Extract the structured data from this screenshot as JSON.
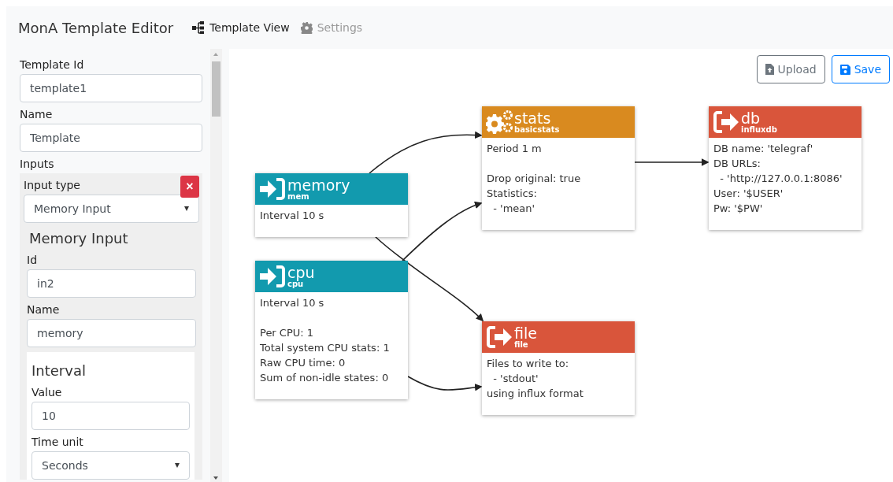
{
  "header": {
    "title": "MonA Template Editor",
    "nav": [
      {
        "label": "Template View",
        "kind": "tree",
        "selected": true
      },
      {
        "label": "Settings",
        "kind": "gear",
        "selected": false
      }
    ]
  },
  "form": {
    "fields": [
      {
        "label": "Template Id",
        "value": "template1"
      },
      {
        "label": "Name",
        "value": "Template"
      }
    ],
    "inputs_label": "Inputs",
    "input_card": {
      "type_label": "Input type",
      "type_value": "Memory Input",
      "remove_button": "×",
      "heading": "Memory Input",
      "fields": [
        {
          "label": "Id",
          "value": "in2"
        },
        {
          "label": "Name",
          "value": "memory"
        }
      ],
      "interval": {
        "heading": "Interval",
        "value_label": "Value",
        "value": "10",
        "unit_label": "Time unit",
        "unit": "Seconds"
      }
    }
  },
  "toolbar": {
    "buttons": [
      {
        "label": "Upload",
        "kind": "upload"
      },
      {
        "label": "Save",
        "kind": "save"
      }
    ]
  },
  "nodes": [
    {
      "kind": "processor",
      "title": "stats",
      "subtitle": "basicstats",
      "color": "#d98a1f",
      "sections": [
        [
          "Period 1 m"
        ],
        [
          "Drop original: true",
          "Statistics:",
          "  - 'mean'"
        ]
      ]
    },
    {
      "kind": "output",
      "title": "db",
      "subtitle": "influxdb",
      "color": "#d9553b",
      "sections": [
        [
          "DB name: 'telegraf'",
          "DB URLs:",
          "  - 'http://127.0.0.1:8086'",
          "User: '$USER'",
          "Pw: '$PW'"
        ]
      ]
    },
    {
      "kind": "input",
      "title": "memory",
      "subtitle": "mem",
      "color": "#129aae",
      "sections": [
        [
          "Interval 10 s"
        ]
      ]
    },
    {
      "kind": "input",
      "title": "cpu",
      "subtitle": "cpu",
      "color": "#129aae",
      "sections": [
        [
          "Interval 10 s"
        ],
        [
          "Per CPU: 1",
          "Total system CPU stats: 1",
          "Raw CPU time: 0",
          "Sum of non-idle states: 0"
        ]
      ]
    },
    {
      "kind": "output",
      "title": "file",
      "subtitle": "file",
      "color": "#d9553b",
      "sections": [
        [
          "Files to write to:",
          "  - 'stdout'",
          "using influx format"
        ]
      ]
    }
  ]
}
